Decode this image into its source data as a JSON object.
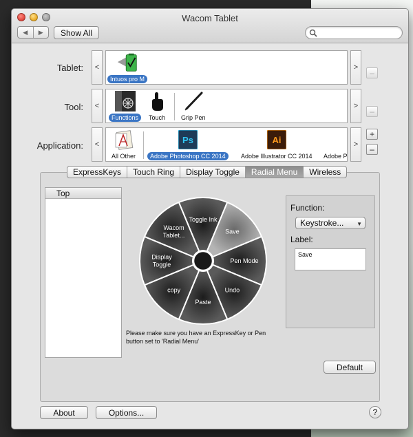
{
  "window": {
    "title": "Wacom Tablet"
  },
  "toolbar": {
    "back_icon": "back-arrow-icon",
    "forward_icon": "forward-arrow-icon",
    "show_all_label": "Show All",
    "search_placeholder": "",
    "search_icon": "magnifier-icon"
  },
  "rows": {
    "tablet": {
      "label": "Tablet:",
      "left_arrow": "<",
      "right_arrow": ">",
      "remove": "–",
      "items": [
        {
          "label": "Intuos pro M",
          "icon": "tablet-battery-icon",
          "selected": true
        }
      ]
    },
    "tool": {
      "label": "Tool:",
      "left_arrow": "<",
      "right_arrow": ">",
      "remove": "–",
      "items": [
        {
          "label": "Functions",
          "icon": "functions-icon",
          "selected": true
        },
        {
          "label": "Touch",
          "icon": "touch-hand-icon",
          "selected": false
        },
        {
          "label": "Grip Pen",
          "icon": "grip-pen-icon",
          "selected": false
        }
      ]
    },
    "application": {
      "label": "Application:",
      "left_arrow": "<",
      "right_arrow": ">",
      "add": "+",
      "remove": "–",
      "items": [
        {
          "label": "All Other",
          "icon": "all-other-apps-icon",
          "selected": false
        },
        {
          "label": "Adobe Photoshop CC 2014",
          "icon": "photoshop-icon",
          "selected": true,
          "glyph": "Ps"
        },
        {
          "label": "Adobe Illustrator CC 2014",
          "icon": "illustrator-icon",
          "selected": false,
          "glyph": "Ai"
        },
        {
          "label": "Adobe P",
          "icon": "",
          "selected": false
        }
      ]
    }
  },
  "tabs": [
    {
      "label": "ExpressKeys",
      "active": false
    },
    {
      "label": "Touch Ring",
      "active": false
    },
    {
      "label": "Display Toggle",
      "active": false
    },
    {
      "label": "Radial Menu",
      "active": true
    },
    {
      "label": "Wireless",
      "active": false
    }
  ],
  "radial_menu": {
    "list_header": "Top",
    "segments": [
      {
        "label_lines": [
          "Toggle Ink"
        ],
        "selected": false
      },
      {
        "label_lines": [
          "Save"
        ],
        "selected": true
      },
      {
        "label_lines": [
          "Pen Mode"
        ],
        "selected": false
      },
      {
        "label_lines": [
          "Undo"
        ],
        "selected": false
      },
      {
        "label_lines": [
          "Paste"
        ],
        "selected": false
      },
      {
        "label_lines": [
          "copy"
        ],
        "selected": false
      },
      {
        "label_lines": [
          "Display",
          "Toggle"
        ],
        "selected": false
      },
      {
        "label_lines": [
          "Wacom",
          "Tablet..."
        ],
        "selected": false
      }
    ],
    "note_lines": [
      "Please make sure you have an ExpressKey or Pen",
      "button set to 'Radial Menu'"
    ]
  },
  "function_panel": {
    "function_label": "Function:",
    "function_value": "Keystroke...",
    "label_label": "Label:",
    "label_value": "Save"
  },
  "buttons": {
    "default_label": "Default",
    "about_label": "About",
    "options_label": "Options...",
    "help_label": "?"
  },
  "colors": {
    "selection_blue": "#3a75c4",
    "wedge_dark": "#4b4b4b",
    "wedge_selected": "#9c9c9c",
    "photoshop_bg": "#1e3b58",
    "photoshop_fg": "#31c5f4",
    "illustrator_bg": "#3b1c0a",
    "illustrator_fg": "#ff9a1e"
  }
}
